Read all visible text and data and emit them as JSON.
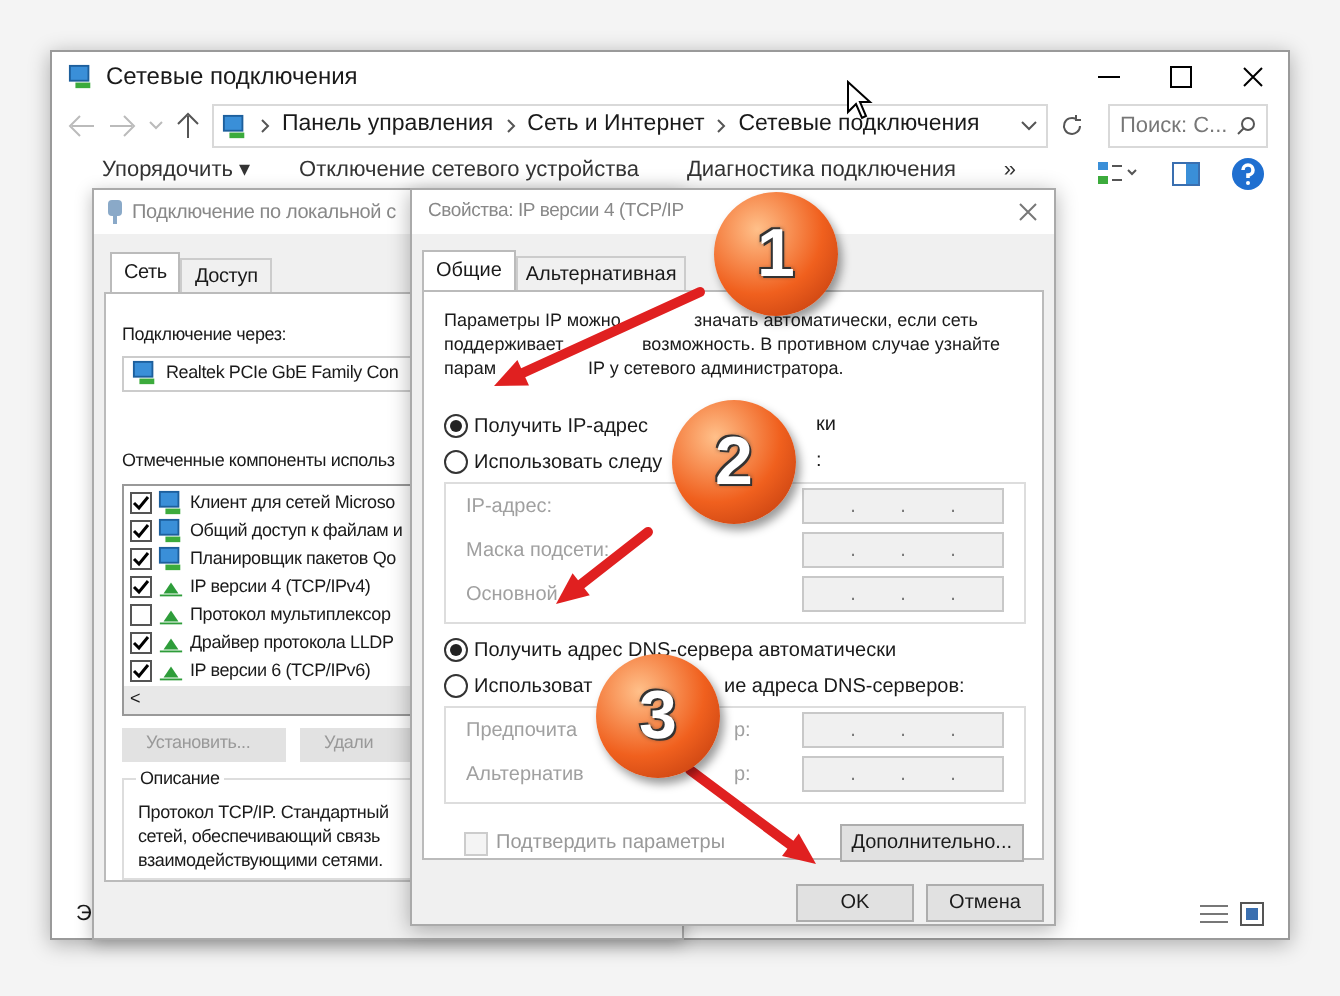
{
  "explorer": {
    "title": "Сетевые подключения",
    "breadcrumbs": [
      "Панель управления",
      "Сеть и Интернет",
      "Сетевые подключения"
    ],
    "search": {
      "placeholder": "Поиск: С..."
    },
    "toolbar": [
      "Упорядочить ▾",
      "Отключение сетевого устройства",
      "Диагностика подключения",
      "»"
    ],
    "status_text": "Э"
  },
  "connection_dialog": {
    "title": "Подключение по локальной с",
    "tabs": [
      {
        "label": "Сеть",
        "selected": true
      },
      {
        "label": "Доступ",
        "selected": false
      }
    ],
    "connect_using_label": "Подключение через:",
    "adapter": "Realtek PCIe GbE Family Con",
    "components_label": "Отмеченные компоненты использ",
    "components": [
      {
        "label": "Клиент для сетей Microso",
        "checked": true,
        "kind": "service"
      },
      {
        "label": "Общий доступ к файлам и",
        "checked": true,
        "kind": "service"
      },
      {
        "label": "Планировщик пакетов Qo",
        "checked": true,
        "kind": "service"
      },
      {
        "label": "IP версии 4 (TCP/IPv4)",
        "checked": true,
        "kind": "protocol"
      },
      {
        "label": "Протокол мультиплексор",
        "checked": false,
        "kind": "protocol"
      },
      {
        "label": "Драйвер протокола LLDP",
        "checked": true,
        "kind": "protocol"
      },
      {
        "label": "IP версии 6 (TCP/IPv6)",
        "checked": true,
        "kind": "protocol"
      }
    ],
    "scroll_left": "<",
    "buttons": [
      {
        "label": "Установить...",
        "disabled": true
      },
      {
        "label": "Удали",
        "disabled": true
      }
    ],
    "description": {
      "title": "Описание",
      "text": "Протокол TCP/IP. Стандартный\nсетей, обеспечивающий связь\nвзаимодействующими сетями."
    }
  },
  "ipv4_dialog": {
    "title": "Свойства: IP версии 4 (TCP/IP",
    "tabs": [
      {
        "label": "Общие",
        "selected": true
      },
      {
        "label": "Альтернативная",
        "selected": false
      }
    ],
    "intro_lines": [
      {
        "left": "Параметры IP можно",
        "right": "значать автоматически, если сеть"
      },
      {
        "left": "поддерживает",
        "right": "возможность. В противном случае узнайте"
      },
      {
        "left": "парам",
        "right": "IP у сетевого администратора."
      }
    ],
    "ip_options": [
      {
        "label": "Получить IP-адрес",
        "label_tail": "ки",
        "selected": true
      },
      {
        "label": "Использовать следу",
        "label_tail": ":",
        "selected": false
      }
    ],
    "ip_fields": [
      {
        "label": "IP-адрес:",
        "disabled": true,
        "segments": [
          ".",
          ".",
          "."
        ]
      },
      {
        "label": "Маска подсети:",
        "disabled": true,
        "segments": [
          ".",
          ".",
          "."
        ]
      },
      {
        "label": "Основной",
        "disabled": true,
        "segments": [
          ".",
          ".",
          "."
        ]
      }
    ],
    "dns_options": [
      {
        "label": "Получить адрес DNS-сервера автоматически",
        "selected": true
      },
      {
        "label": "Использоват",
        "label_tail": "ие адреса DNS-серверов:",
        "selected": false
      }
    ],
    "dns_fields": [
      {
        "label": "Предпочита",
        "label_tail": "р:",
        "disabled": true,
        "segments": [
          ".",
          ".",
          "."
        ]
      },
      {
        "label": "Альтернатив",
        "label_tail": "р:",
        "disabled": true,
        "segments": [
          ".",
          ".",
          "."
        ]
      }
    ],
    "validate": {
      "label": "Подтвердить параметры",
      "checked": false,
      "disabled": true
    },
    "advanced_button": "Дополнительно...",
    "buttons": [
      "OK",
      "Отмена"
    ]
  },
  "annotations": [
    {
      "number": "1"
    },
    {
      "number": "2"
    },
    {
      "number": "3"
    }
  ]
}
